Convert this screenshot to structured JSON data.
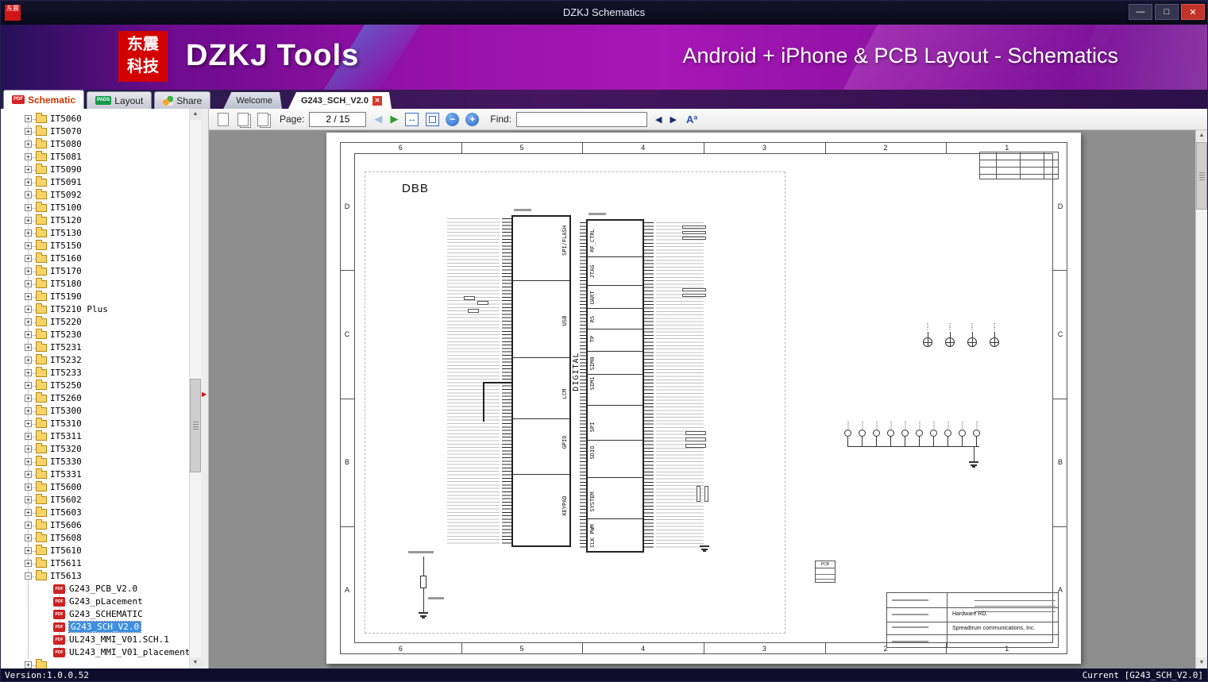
{
  "window": {
    "title": "DZKJ Schematics"
  },
  "icons": {
    "minimize": "—",
    "maximize": "□",
    "close": "✕",
    "tab_close": "✕",
    "pdf_label": "PDF",
    "pads_label": "PADS",
    "left": "◀",
    "right": "▶",
    "up": "▲",
    "down": "▼",
    "plus": "+",
    "minus": "−",
    "plus_sq": "+",
    "minus_sq": "−",
    "fit_width": "↔",
    "search_prev": "◀",
    "search_next": "▶",
    "splitter_arrow": "▶"
  },
  "banner": {
    "logo_line1": "东震",
    "logo_line2": "科技",
    "app_name": "DZKJ Tools",
    "tagline": "Android + iPhone & PCB Layout - Schematics"
  },
  "main_tabs": [
    {
      "label": "Schematic",
      "active": true
    },
    {
      "label": "Layout",
      "active": false
    },
    {
      "label": "Share",
      "active": false
    }
  ],
  "doc_tabs": [
    {
      "label": "Welcome",
      "active": false
    },
    {
      "label": "G243_SCH_V2.0",
      "active": true
    }
  ],
  "toolbar": {
    "page_label": "Page:",
    "page_value": "2 / 15",
    "find_label": "Find:",
    "find_value": "",
    "match_case": "Aª"
  },
  "statusbar": {
    "left": "Version:1.0.0.52",
    "right": "Current [G243_SCH_V2.0]"
  },
  "tree": [
    {
      "t": "folder",
      "label": "IT5060"
    },
    {
      "t": "folder",
      "label": "IT5070"
    },
    {
      "t": "folder",
      "label": "IT5080"
    },
    {
      "t": "folder",
      "label": "IT5081"
    },
    {
      "t": "folder",
      "label": "IT5090"
    },
    {
      "t": "folder",
      "label": "IT5091"
    },
    {
      "t": "folder",
      "label": "IT5092"
    },
    {
      "t": "folder",
      "label": "IT5100"
    },
    {
      "t": "folder",
      "label": "IT5120"
    },
    {
      "t": "folder",
      "label": "IT5130"
    },
    {
      "t": "folder",
      "label": "IT5150"
    },
    {
      "t": "folder",
      "label": "IT5160"
    },
    {
      "t": "folder",
      "label": "IT5170"
    },
    {
      "t": "folder",
      "label": "IT5180"
    },
    {
      "t": "folder",
      "label": "IT5190"
    },
    {
      "t": "folder",
      "label": "IT5210 Plus"
    },
    {
      "t": "folder",
      "label": "IT5220"
    },
    {
      "t": "folder",
      "label": "IT5230"
    },
    {
      "t": "folder",
      "label": "IT5231"
    },
    {
      "t": "folder",
      "label": "IT5232"
    },
    {
      "t": "folder",
      "label": "IT5233"
    },
    {
      "t": "folder",
      "label": "IT5250"
    },
    {
      "t": "folder",
      "label": "IT5260"
    },
    {
      "t": "folder",
      "label": "IT5300"
    },
    {
      "t": "folder",
      "label": "IT5310"
    },
    {
      "t": "folder",
      "label": "IT5311"
    },
    {
      "t": "folder",
      "label": "IT5320"
    },
    {
      "t": "folder",
      "label": "IT5330"
    },
    {
      "t": "folder",
      "label": "IT5331"
    },
    {
      "t": "folder",
      "label": "IT5600"
    },
    {
      "t": "folder",
      "label": "IT5602"
    },
    {
      "t": "folder",
      "label": "IT5603"
    },
    {
      "t": "folder",
      "label": "IT5606"
    },
    {
      "t": "folder",
      "label": "IT5608"
    },
    {
      "t": "folder",
      "label": "IT5610"
    },
    {
      "t": "folder",
      "label": "IT5611"
    },
    {
      "t": "folder",
      "label": "IT5613",
      "expanded": true
    },
    {
      "t": "file",
      "label": "G243_PCB_V2.0"
    },
    {
      "t": "file",
      "label": "G243_pLacement"
    },
    {
      "t": "file",
      "label": "G243_SCHEMATIC"
    },
    {
      "t": "file",
      "label": "G243_SCH_V2.0",
      "selected": true
    },
    {
      "t": "file",
      "label": "UL243_MMI_V01.SCH.1"
    },
    {
      "t": "file",
      "label": "UL243_MMI_V01_placement"
    },
    {
      "t": "folder",
      "label": ""
    }
  ],
  "schematic": {
    "title": "DBB",
    "grid_columns": [
      "6",
      "5",
      "4",
      "3",
      "2",
      "1"
    ],
    "grid_rows": [
      "D",
      "C",
      "B",
      "A"
    ],
    "left_block": {
      "name": "DIGITAL",
      "sections": [
        {
          "label": "SPI/FLASH",
          "y": 0.072
        },
        {
          "label": "USB",
          "y": 0.316
        },
        {
          "label": "LCM",
          "y": 0.538
        },
        {
          "label": "GPIO",
          "y": 0.687
        },
        {
          "label": "KEYPAD",
          "y": 0.88
        }
      ]
    },
    "right_block": {
      "sections": [
        {
          "label": "RF_CTRL",
          "y": 0.06
        },
        {
          "label": "JTAG",
          "y": 0.155
        },
        {
          "label": "UART",
          "y": 0.233
        },
        {
          "label": "RS",
          "y": 0.298
        },
        {
          "label": "TP",
          "y": 0.357
        },
        {
          "label": "SIM0",
          "y": 0.433
        },
        {
          "label": "SIM1",
          "y": 0.493
        },
        {
          "label": "SPI",
          "y": 0.624
        },
        {
          "label": "SDIO",
          "y": 0.702
        },
        {
          "label": "SYSTEM",
          "y": 0.85
        },
        {
          "label": "CLK PWM",
          "y": 0.955
        }
      ]
    },
    "note_label": "PCB",
    "title_block": {
      "dept": "Hardware RD.",
      "company": "Spreadtrum communications, Inc."
    }
  }
}
